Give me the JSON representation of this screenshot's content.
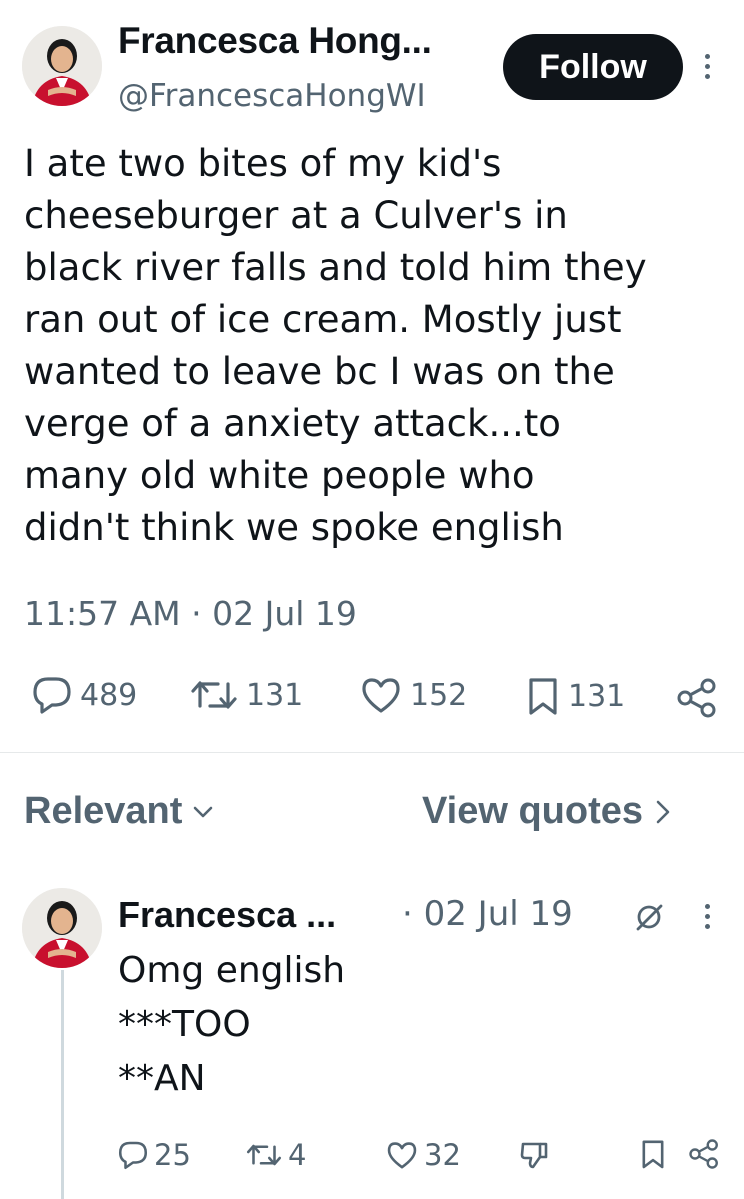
{
  "tweet": {
    "author_name": "Francesca Hong...",
    "handle": "@FrancescaHongWI",
    "follow_label": "Follow",
    "text_lines": [
      "I ate two bites of my kid's",
      "cheeseburger at a Culver's in",
      "black river falls and told him they",
      "ran out of ice cream. Mostly just",
      "wanted to leave bc I was on the",
      "verge of a anxiety attack...to",
      "many old white people who",
      "didn't think we spoke english"
    ],
    "time": "11:57 AM",
    "separator": "·",
    "date": "02 Jul 19",
    "stats": {
      "replies": "489",
      "reposts": "131",
      "likes": "152",
      "bookmarks": "131"
    },
    "icons": [
      "reply-icon",
      "repost-icon",
      "like-icon",
      "bookmark-icon",
      "share-icon",
      "more-icon"
    ]
  },
  "sort": {
    "label": "Relevant",
    "view_quotes_label": "View quotes"
  },
  "reply": {
    "author_name": "Francesca ...",
    "date": "· 02 Jul 19",
    "lines": [
      "Omg english",
      "***TOO",
      "**AN"
    ],
    "stats": {
      "replies": "25",
      "reposts": "4",
      "likes": "32"
    },
    "icons": [
      "grok-icon",
      "more-icon",
      "reply-icon",
      "repost-icon",
      "like-icon",
      "dislike-icon",
      "bookmark-icon",
      "share-icon"
    ]
  },
  "colors": {
    "text": "#0f1419",
    "secondary": "#536471",
    "follow_bg": "#0f1419",
    "avatar_jacket": "#c8102e"
  }
}
